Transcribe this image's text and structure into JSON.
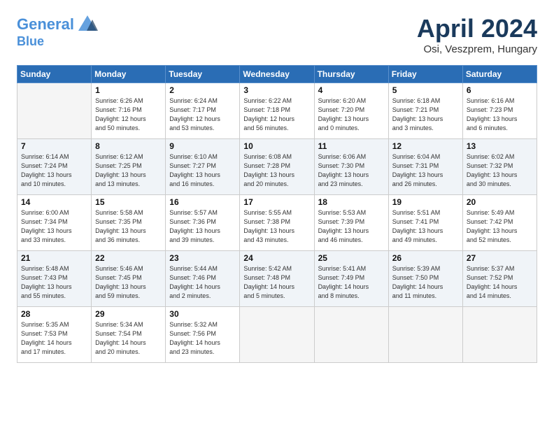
{
  "header": {
    "logo_line1": "General",
    "logo_line2": "Blue",
    "month_title": "April 2024",
    "subtitle": "Osi, Veszprem, Hungary"
  },
  "weekdays": [
    "Sunday",
    "Monday",
    "Tuesday",
    "Wednesday",
    "Thursday",
    "Friday",
    "Saturday"
  ],
  "weeks": [
    [
      {
        "day": "",
        "info": ""
      },
      {
        "day": "1",
        "info": "Sunrise: 6:26 AM\nSunset: 7:16 PM\nDaylight: 12 hours\nand 50 minutes."
      },
      {
        "day": "2",
        "info": "Sunrise: 6:24 AM\nSunset: 7:17 PM\nDaylight: 12 hours\nand 53 minutes."
      },
      {
        "day": "3",
        "info": "Sunrise: 6:22 AM\nSunset: 7:18 PM\nDaylight: 12 hours\nand 56 minutes."
      },
      {
        "day": "4",
        "info": "Sunrise: 6:20 AM\nSunset: 7:20 PM\nDaylight: 13 hours\nand 0 minutes."
      },
      {
        "day": "5",
        "info": "Sunrise: 6:18 AM\nSunset: 7:21 PM\nDaylight: 13 hours\nand 3 minutes."
      },
      {
        "day": "6",
        "info": "Sunrise: 6:16 AM\nSunset: 7:23 PM\nDaylight: 13 hours\nand 6 minutes."
      }
    ],
    [
      {
        "day": "7",
        "info": "Sunrise: 6:14 AM\nSunset: 7:24 PM\nDaylight: 13 hours\nand 10 minutes."
      },
      {
        "day": "8",
        "info": "Sunrise: 6:12 AM\nSunset: 7:25 PM\nDaylight: 13 hours\nand 13 minutes."
      },
      {
        "day": "9",
        "info": "Sunrise: 6:10 AM\nSunset: 7:27 PM\nDaylight: 13 hours\nand 16 minutes."
      },
      {
        "day": "10",
        "info": "Sunrise: 6:08 AM\nSunset: 7:28 PM\nDaylight: 13 hours\nand 20 minutes."
      },
      {
        "day": "11",
        "info": "Sunrise: 6:06 AM\nSunset: 7:30 PM\nDaylight: 13 hours\nand 23 minutes."
      },
      {
        "day": "12",
        "info": "Sunrise: 6:04 AM\nSunset: 7:31 PM\nDaylight: 13 hours\nand 26 minutes."
      },
      {
        "day": "13",
        "info": "Sunrise: 6:02 AM\nSunset: 7:32 PM\nDaylight: 13 hours\nand 30 minutes."
      }
    ],
    [
      {
        "day": "14",
        "info": "Sunrise: 6:00 AM\nSunset: 7:34 PM\nDaylight: 13 hours\nand 33 minutes."
      },
      {
        "day": "15",
        "info": "Sunrise: 5:58 AM\nSunset: 7:35 PM\nDaylight: 13 hours\nand 36 minutes."
      },
      {
        "day": "16",
        "info": "Sunrise: 5:57 AM\nSunset: 7:36 PM\nDaylight: 13 hours\nand 39 minutes."
      },
      {
        "day": "17",
        "info": "Sunrise: 5:55 AM\nSunset: 7:38 PM\nDaylight: 13 hours\nand 43 minutes."
      },
      {
        "day": "18",
        "info": "Sunrise: 5:53 AM\nSunset: 7:39 PM\nDaylight: 13 hours\nand 46 minutes."
      },
      {
        "day": "19",
        "info": "Sunrise: 5:51 AM\nSunset: 7:41 PM\nDaylight: 13 hours\nand 49 minutes."
      },
      {
        "day": "20",
        "info": "Sunrise: 5:49 AM\nSunset: 7:42 PM\nDaylight: 13 hours\nand 52 minutes."
      }
    ],
    [
      {
        "day": "21",
        "info": "Sunrise: 5:48 AM\nSunset: 7:43 PM\nDaylight: 13 hours\nand 55 minutes."
      },
      {
        "day": "22",
        "info": "Sunrise: 5:46 AM\nSunset: 7:45 PM\nDaylight: 13 hours\nand 59 minutes."
      },
      {
        "day": "23",
        "info": "Sunrise: 5:44 AM\nSunset: 7:46 PM\nDaylight: 14 hours\nand 2 minutes."
      },
      {
        "day": "24",
        "info": "Sunrise: 5:42 AM\nSunset: 7:48 PM\nDaylight: 14 hours\nand 5 minutes."
      },
      {
        "day": "25",
        "info": "Sunrise: 5:41 AM\nSunset: 7:49 PM\nDaylight: 14 hours\nand 8 minutes."
      },
      {
        "day": "26",
        "info": "Sunrise: 5:39 AM\nSunset: 7:50 PM\nDaylight: 14 hours\nand 11 minutes."
      },
      {
        "day": "27",
        "info": "Sunrise: 5:37 AM\nSunset: 7:52 PM\nDaylight: 14 hours\nand 14 minutes."
      }
    ],
    [
      {
        "day": "28",
        "info": "Sunrise: 5:35 AM\nSunset: 7:53 PM\nDaylight: 14 hours\nand 17 minutes."
      },
      {
        "day": "29",
        "info": "Sunrise: 5:34 AM\nSunset: 7:54 PM\nDaylight: 14 hours\nand 20 minutes."
      },
      {
        "day": "30",
        "info": "Sunrise: 5:32 AM\nSunset: 7:56 PM\nDaylight: 14 hours\nand 23 minutes."
      },
      {
        "day": "",
        "info": ""
      },
      {
        "day": "",
        "info": ""
      },
      {
        "day": "",
        "info": ""
      },
      {
        "day": "",
        "info": ""
      }
    ]
  ]
}
